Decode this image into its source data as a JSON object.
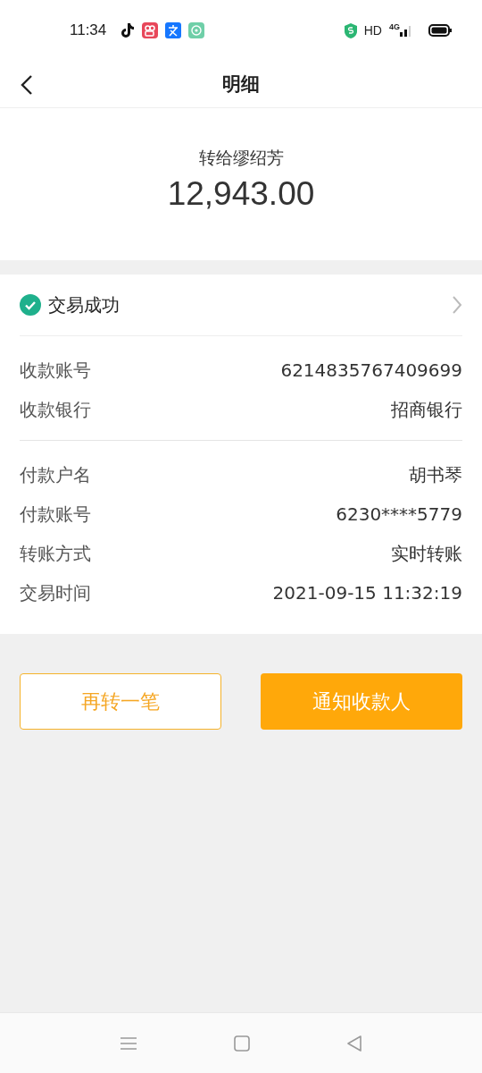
{
  "status_bar": {
    "time": "11:34",
    "network": "HD",
    "signal": "4G"
  },
  "header": {
    "title": "明细"
  },
  "summary": {
    "recipient": "转给缪绍芳",
    "amount": "12,943.00"
  },
  "status": {
    "label": "交易成功",
    "success": true
  },
  "groups": [
    {
      "rows": [
        {
          "label": "收款账号",
          "value": "6214835767409699"
        },
        {
          "label": "收款银行",
          "value": "招商银行"
        }
      ]
    },
    {
      "rows": [
        {
          "label": "付款户名",
          "value": "胡书琴"
        },
        {
          "label": "付款账号",
          "value": "6230****5779"
        },
        {
          "label": "转账方式",
          "value": "实时转账"
        },
        {
          "label": "交易时间",
          "value": "2021-09-15 11:32:19"
        }
      ]
    }
  ],
  "buttons": [
    {
      "label": "再转一笔",
      "kind": "outline"
    },
    {
      "label": "通知收款人",
      "kind": "filled"
    }
  ]
}
